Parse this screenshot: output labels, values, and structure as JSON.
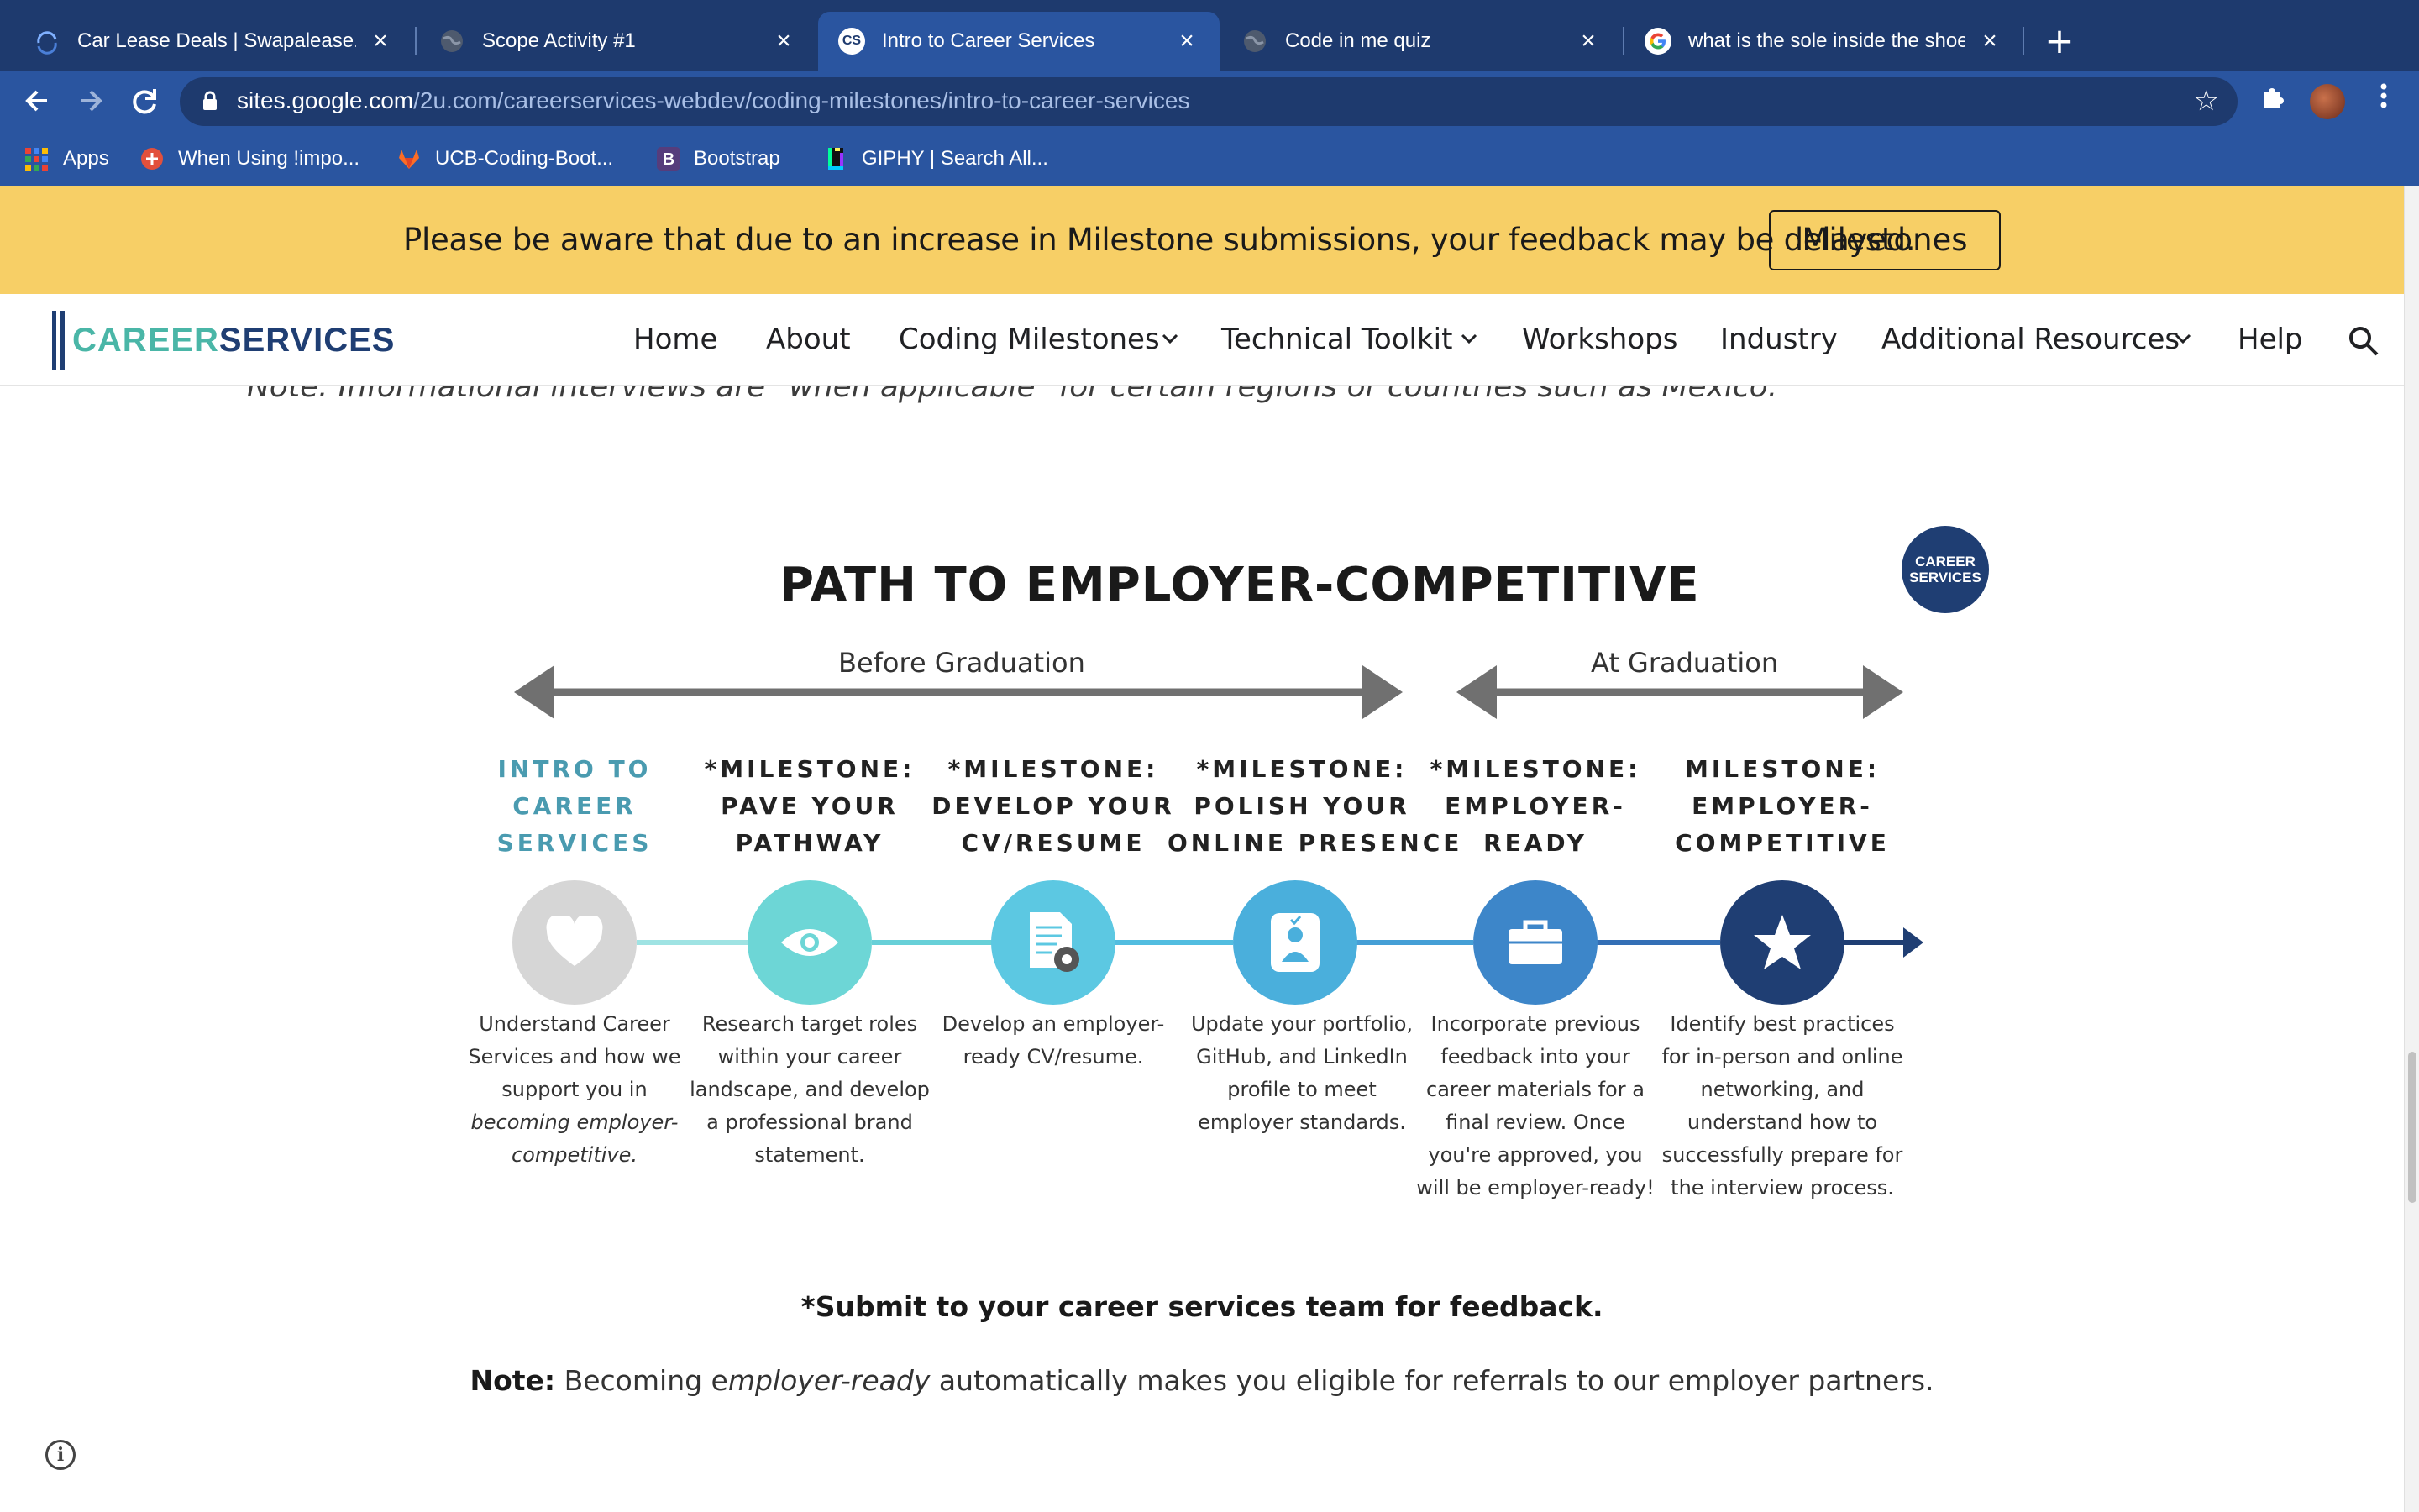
{
  "browser": {
    "tabs": [
      {
        "title": "Car Lease Deals | Swapalease.",
        "favicon": "swapalease-icon",
        "active": false
      },
      {
        "title": "Scope Activity #1",
        "favicon": "globe-icon",
        "active": false
      },
      {
        "title": "Intro to Career Services",
        "favicon": "cs-icon",
        "favicon_text": "CS",
        "active": true
      },
      {
        "title": "Code in me quiz",
        "favicon": "globe-icon",
        "active": false
      },
      {
        "title": "what is the sole inside the shoe",
        "favicon": "google-icon",
        "active": false
      }
    ],
    "url_host": "sites.google.com",
    "url_path": "/2u.com/careerservices-webdev/coding-milestones/intro-to-career-services",
    "bookmarks": [
      {
        "label": "Apps",
        "icon": "apps-grid-icon"
      },
      {
        "label": "When Using !impo...",
        "icon": "red-circle-icon"
      },
      {
        "label": "UCB-Coding-Boot...",
        "icon": "gitlab-icon"
      },
      {
        "label": "Bootstrap",
        "icon": "bootstrap-icon",
        "icon_text": "B"
      },
      {
        "label": "GIPHY | Search All...",
        "icon": "giphy-icon"
      }
    ]
  },
  "banner": {
    "text": "Please be aware that due to an increase in Milestone submissions, your feedback may be delayed.",
    "button": "Milestones",
    "color": "#f7cf66"
  },
  "site_nav": {
    "logo_part1": "CAREER",
    "logo_part2": "SERVICES",
    "items": [
      {
        "label": "Home",
        "dropdown": false
      },
      {
        "label": "About",
        "dropdown": false
      },
      {
        "label": "Coding Milestones",
        "dropdown": true
      },
      {
        "label": "Technical Toolkit",
        "dropdown": true
      },
      {
        "label": "Workshops",
        "dropdown": false
      },
      {
        "label": "Industry",
        "dropdown": false
      },
      {
        "label": "Additional Resources",
        "dropdown": true
      },
      {
        "label": "Help",
        "dropdown": false
      }
    ]
  },
  "content": {
    "note_top": "Note: Informational interviews are \"when applicable\" for certain regions or countries such as Mexico.",
    "infographic": {
      "title": "PATH TO EMPLOYER-COMPETITIVE",
      "badge_line1": "CAREER",
      "badge_line2": "SERVICES",
      "phase_before": "Before Graduation",
      "phase_at": "At Graduation",
      "steps": [
        {
          "head": [
            "INTRO TO",
            "CAREER",
            "SERVICES"
          ],
          "icon": "heart-icon",
          "color": "#d6d6d6",
          "desc": [
            "Understand Career",
            "Services and how we",
            "support you in",
            "becoming employer-",
            "competitive."
          ]
        },
        {
          "head": [
            "*MILESTONE:",
            "PAVE YOUR",
            "PATHWAY"
          ],
          "icon": "eye-icon",
          "color": "#6dd6d6",
          "desc": [
            "Research target roles",
            "within your career",
            "landscape, and develop",
            "a professional brand",
            "statement."
          ]
        },
        {
          "head": [
            "*MILESTONE:",
            "DEVELOP YOUR",
            "CV/RESUME"
          ],
          "icon": "document-gear-icon",
          "color": "#5cc8e2",
          "desc": [
            "Develop an employer-",
            "ready CV/resume."
          ]
        },
        {
          "head": [
            "*MILESTONE:",
            "POLISH YOUR",
            "ONLINE PRESENCE"
          ],
          "icon": "profile-icon",
          "color": "#4aafdc",
          "desc": [
            "Update your portfolio,",
            "GitHub, and LinkedIn",
            "profile to meet",
            "employer standards."
          ]
        },
        {
          "head": [
            "*MILESTONE:",
            "EMPLOYER-",
            "READY"
          ],
          "icon": "briefcase-icon",
          "color": "#3d86c9",
          "desc": [
            "Incorporate previous",
            "feedback into your",
            "career materials for a",
            "final review. Once",
            "you're approved, you",
            "will be employer-ready!"
          ]
        },
        {
          "head": [
            "MILESTONE:",
            "EMPLOYER-",
            "COMPETITIVE"
          ],
          "icon": "star-icon",
          "color": "#1f3e73",
          "desc": [
            "Identify best practices",
            "for in-person and online",
            "networking, and",
            "understand how to",
            "successfully prepare for",
            "the interview process."
          ]
        }
      ]
    },
    "submit_note": "*Submit to your career services team for feedback.",
    "note_bottom_label": "Note:",
    "note_bottom_pre": " Becoming e",
    "note_bottom_em": "mployer-ready",
    "note_bottom_post": " automatically makes you eligible for referrals to our employer partners."
  }
}
